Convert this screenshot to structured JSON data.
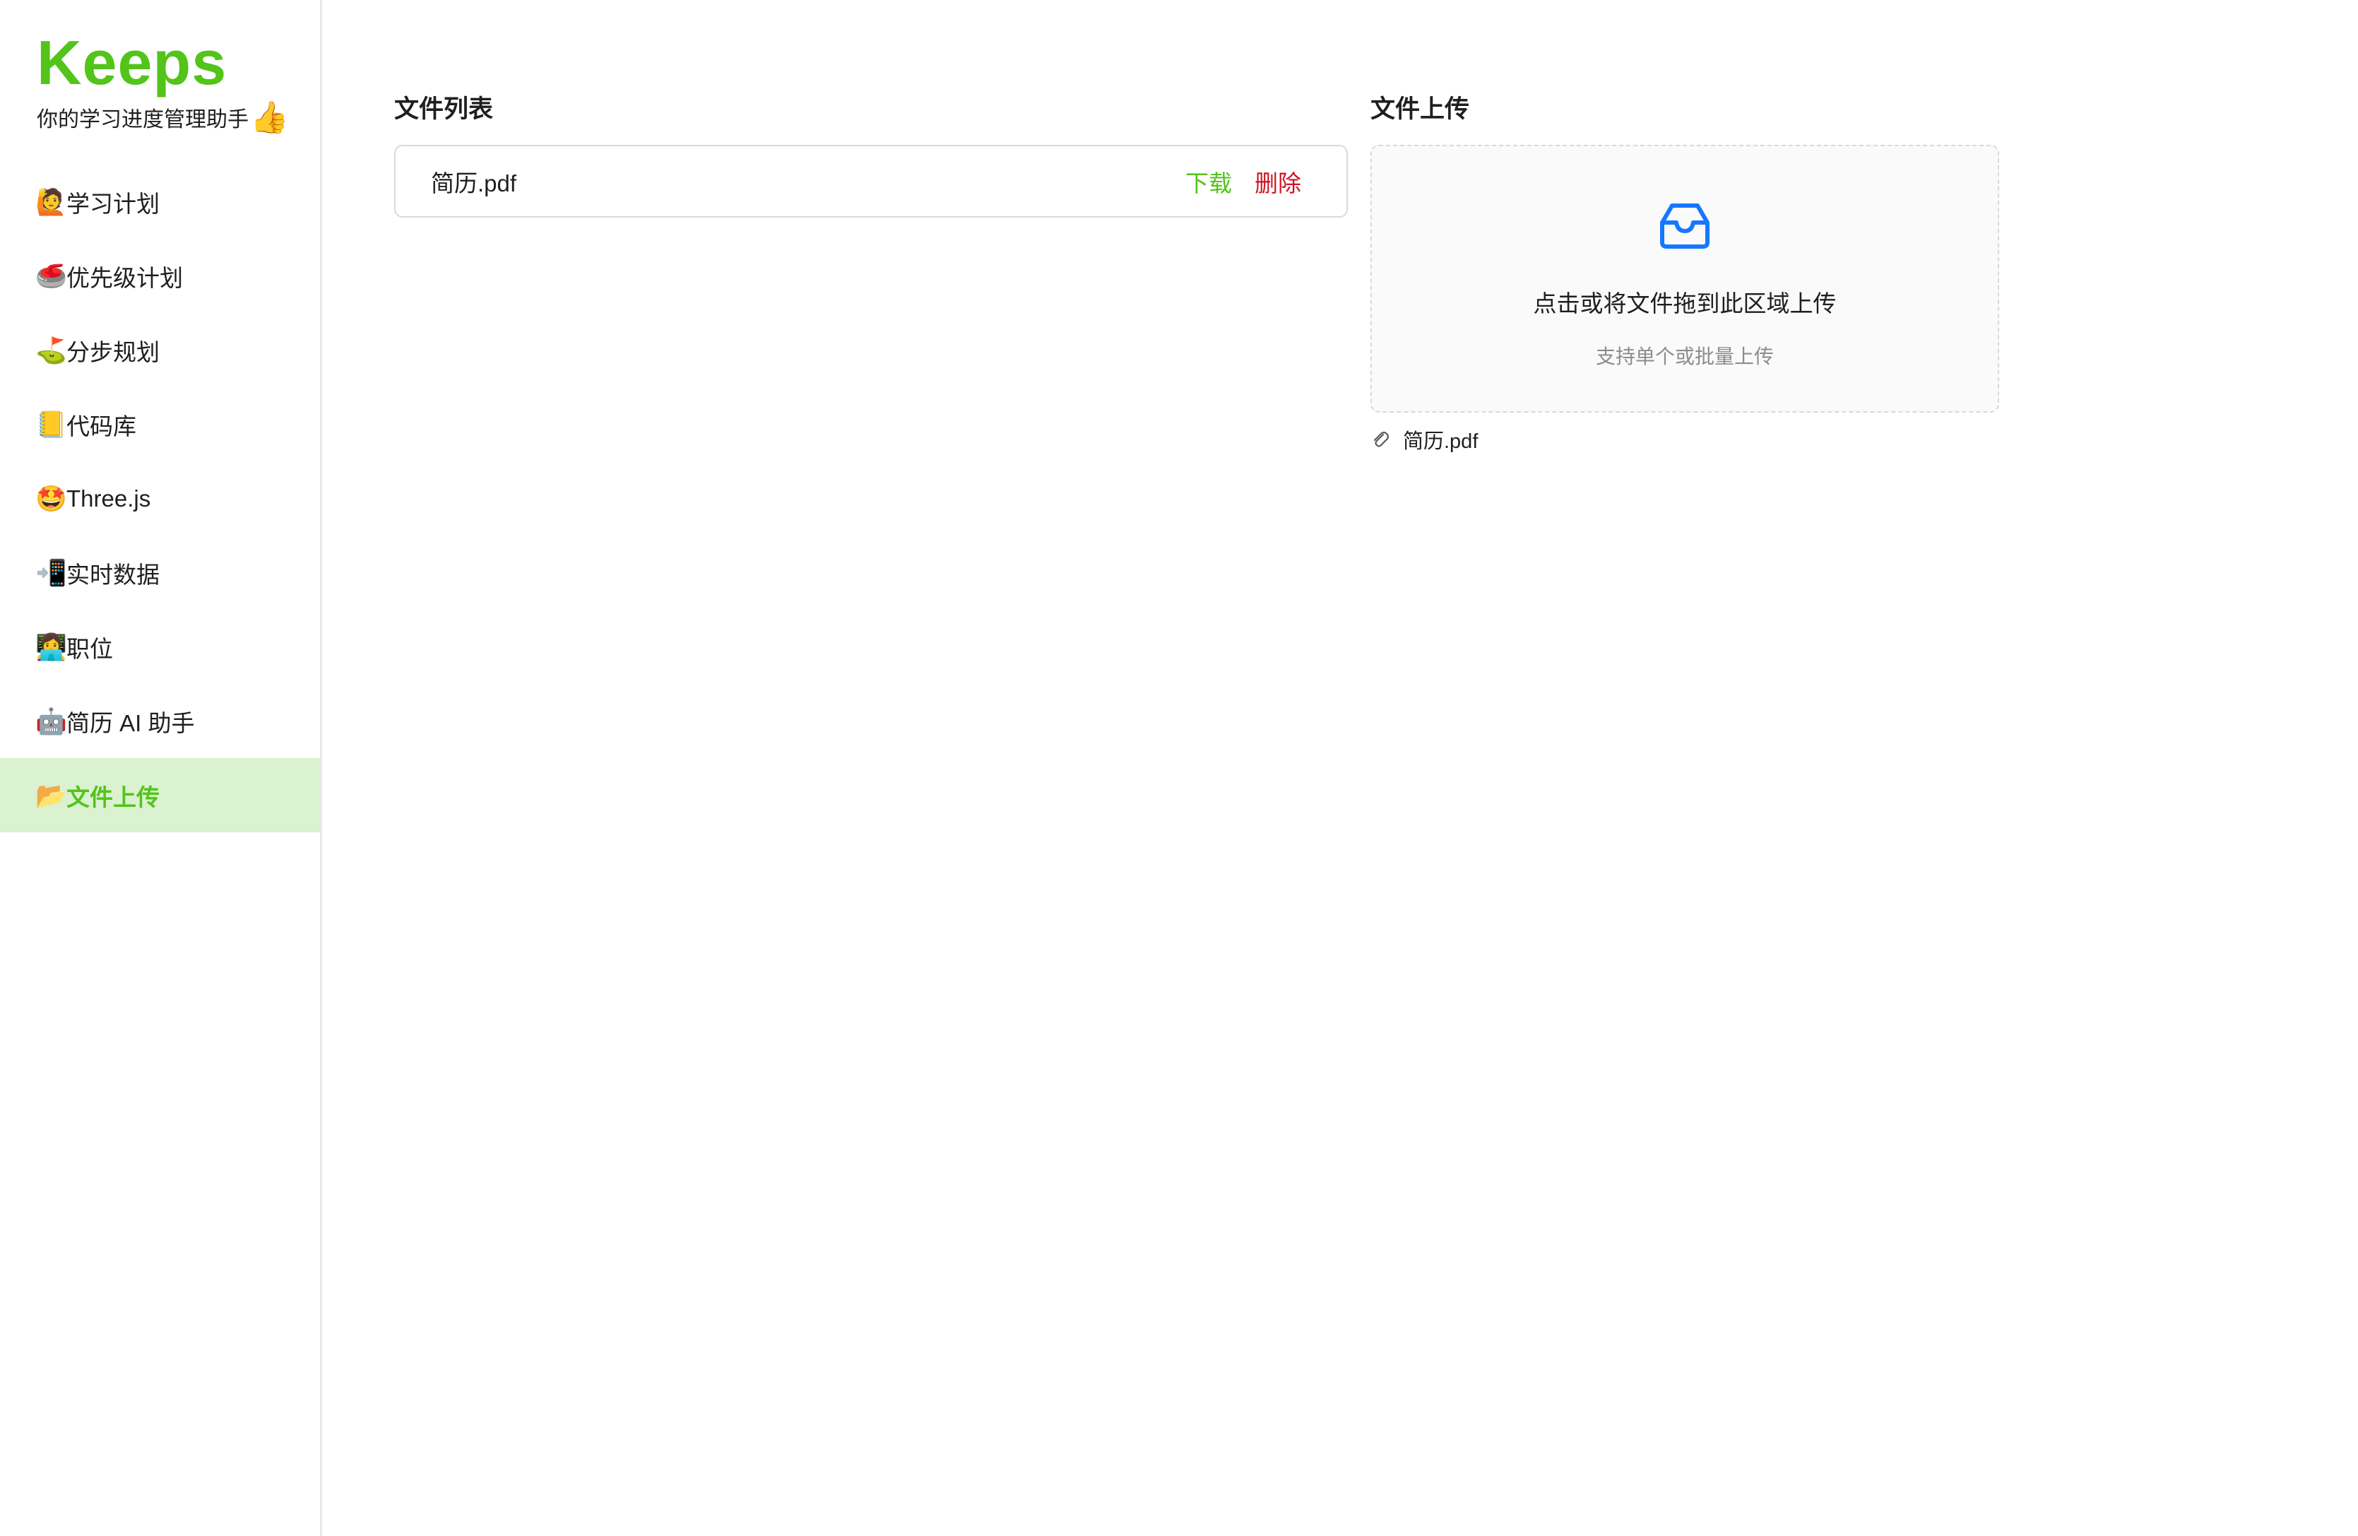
{
  "brand": {
    "title": "Keeps",
    "tagline": "你的学习进度管理助手",
    "tagline_emoji": "👍"
  },
  "sidebar": {
    "items": [
      {
        "emoji": "🙋",
        "label": "学习计划",
        "active": false
      },
      {
        "emoji": "🥌",
        "label": "优先级计划",
        "active": false
      },
      {
        "emoji": "⛳",
        "label": "分步规划",
        "active": false
      },
      {
        "emoji": "📒",
        "label": "代码库",
        "active": false
      },
      {
        "emoji": "🤩",
        "label": "Three.js",
        "active": false
      },
      {
        "emoji": "📲",
        "label": "实时数据",
        "active": false
      },
      {
        "emoji": "👩‍💻",
        "label": "职位",
        "active": false
      },
      {
        "emoji": "🤖",
        "label": "简历 AI 助手",
        "active": false
      },
      {
        "emoji": "📂",
        "label": "文件上传",
        "active": true
      }
    ]
  },
  "file_list": {
    "title": "文件列表",
    "files": [
      {
        "name": "简历.pdf",
        "download_label": "下载",
        "delete_label": "删除"
      }
    ]
  },
  "upload": {
    "title": "文件上传",
    "drop_text": "点击或将文件拖到此区域上传",
    "hint": "支持单个或批量上传",
    "uploaded_files": [
      "简历.pdf"
    ]
  },
  "colors": {
    "brand": "#52c41a",
    "active_bg": "#daf2cf",
    "delete": "#cf1322",
    "icon_blue": "#1677ff"
  },
  "icons": {
    "dropzone": "inbox-icon",
    "uploaded_file": "paperclip-icon"
  }
}
